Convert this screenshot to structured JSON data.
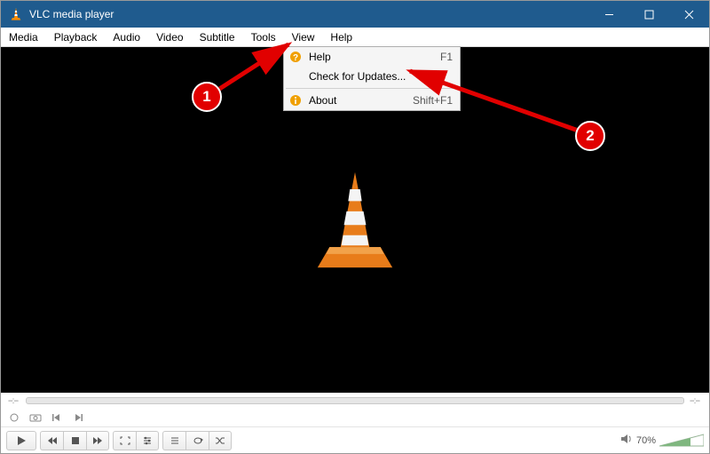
{
  "titlebar": {
    "title": "VLC media player"
  },
  "menubar": {
    "items": [
      "Media",
      "Playback",
      "Audio",
      "Video",
      "Subtitle",
      "Tools",
      "View",
      "Help"
    ]
  },
  "help_menu": {
    "items": [
      {
        "label": "Help",
        "accel": "F1",
        "icon": "question"
      },
      {
        "label": "Check for Updates...",
        "accel": "",
        "icon": ""
      },
      {
        "label": "About",
        "accel": "Shift+F1",
        "icon": "info"
      }
    ]
  },
  "volume": {
    "percent_label": "70%",
    "percent_value": 70
  },
  "annotations": {
    "badge1": "1",
    "badge2": "2"
  }
}
